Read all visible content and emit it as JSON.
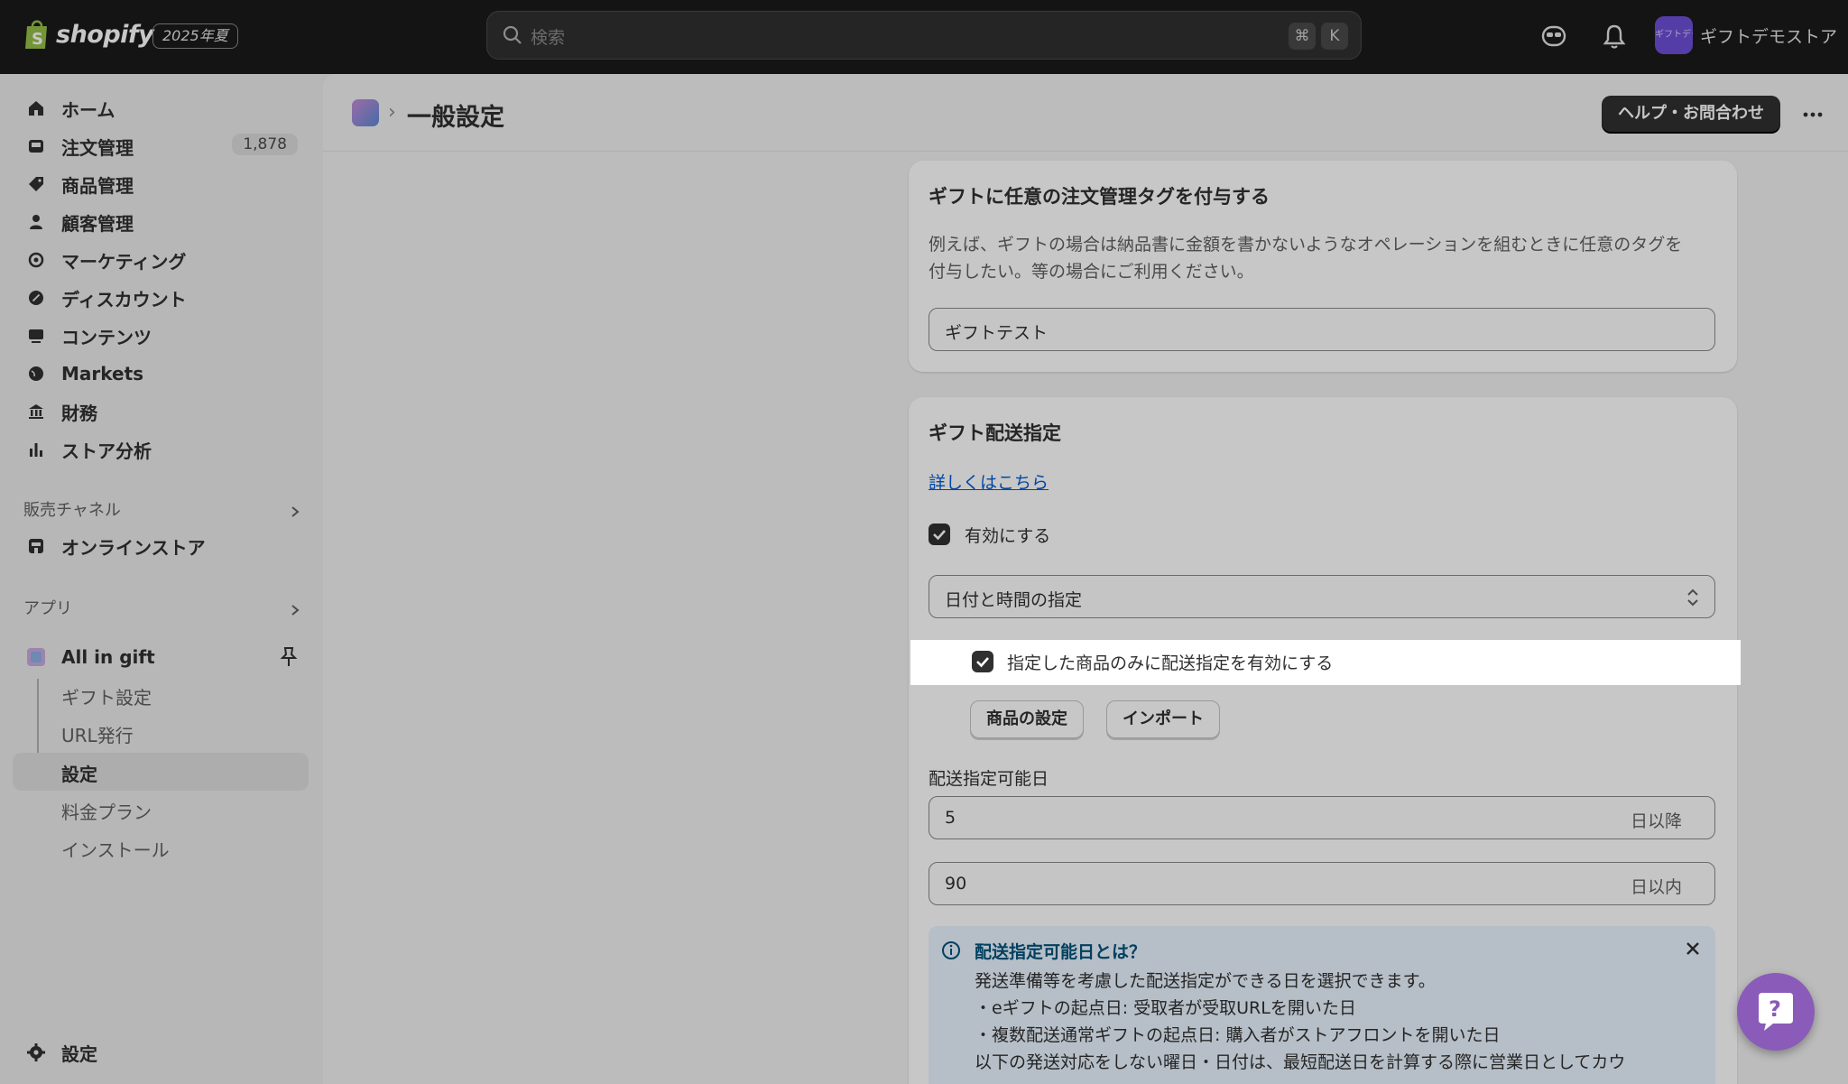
{
  "topbar": {
    "brand": "shopify",
    "edition": "2025年夏",
    "search_placeholder": "検索",
    "shortcut_cmd": "⌘",
    "shortcut_key": "K",
    "store_avatar_text": "ギフトデモストア",
    "store_name": "ギフトデモストア"
  },
  "sidebar": {
    "items": [
      {
        "label": "ホーム",
        "icon": "home-icon"
      },
      {
        "label": "注文管理",
        "icon": "inbox-icon",
        "count": "1,878"
      },
      {
        "label": "商品管理",
        "icon": "tag-icon"
      },
      {
        "label": "顧客管理",
        "icon": "person-icon"
      },
      {
        "label": "マーケティング",
        "icon": "target-icon"
      },
      {
        "label": "ディスカウント",
        "icon": "discount-icon"
      },
      {
        "label": "コンテンツ",
        "icon": "content-icon"
      },
      {
        "label": "Markets",
        "icon": "globe-icon"
      },
      {
        "label": "財務",
        "icon": "bank-icon"
      },
      {
        "label": "ストア分析",
        "icon": "bar-chart-icon"
      }
    ],
    "sales_channels_heading": "販売チャネル",
    "online_store": "オンラインストア",
    "apps_heading": "アプリ",
    "app_name": "All in gift",
    "app_sub_items": [
      "ギフト設定",
      "URL発行",
      "設定",
      "料金プラン",
      "インストール"
    ],
    "settings": "設定"
  },
  "header": {
    "page_title": "一般設定",
    "help_button": "ヘルプ・お問合わせ"
  },
  "tag_card": {
    "title": "ギフトに任意の注文管理タグを付与する",
    "description_line1": "例えば、ギフトの場合は納品書に金額を書かないようなオペレーションを組むときに任意のタグを",
    "description_line2": "付与したい。等の場合にご利用ください。",
    "tag_value": "ギフトテスト"
  },
  "delivery_card": {
    "title": "ギフト配送指定",
    "details_link": "詳しくはこちら",
    "enable_label": "有効にする",
    "enable_checked": true,
    "mode_select": "日付と時間の指定",
    "product_only_label": "指定した商品のみに配送指定を有効にする",
    "product_only_checked": true,
    "product_settings_button": "商品の設定",
    "import_button": "インポート",
    "available_days_label": "配送指定可能日",
    "min_days_value": "5",
    "min_days_suffix": "日以降",
    "max_days_value": "90",
    "max_days_suffix": "日以内",
    "info": {
      "title": "配送指定可能日とは？",
      "line1": "発送準備等を考慮した配送指定ができる日を選択できます。",
      "line2": "・eギフトの起点日: 受取者が受取URLを開いた日",
      "line3": "・複数配送通常ギフトの起点日: 購入者がストアフロントを開いた日",
      "line4": "以下の発送対応をしない曜日・日付は、最短配送日を計算する際に営業日としてカウ"
    }
  },
  "colors": {
    "topbar": "#1a1a1a",
    "accent_link": "#005bd3",
    "avatar": "#6e4fd6",
    "chat_fab": "#8a5bb8"
  }
}
